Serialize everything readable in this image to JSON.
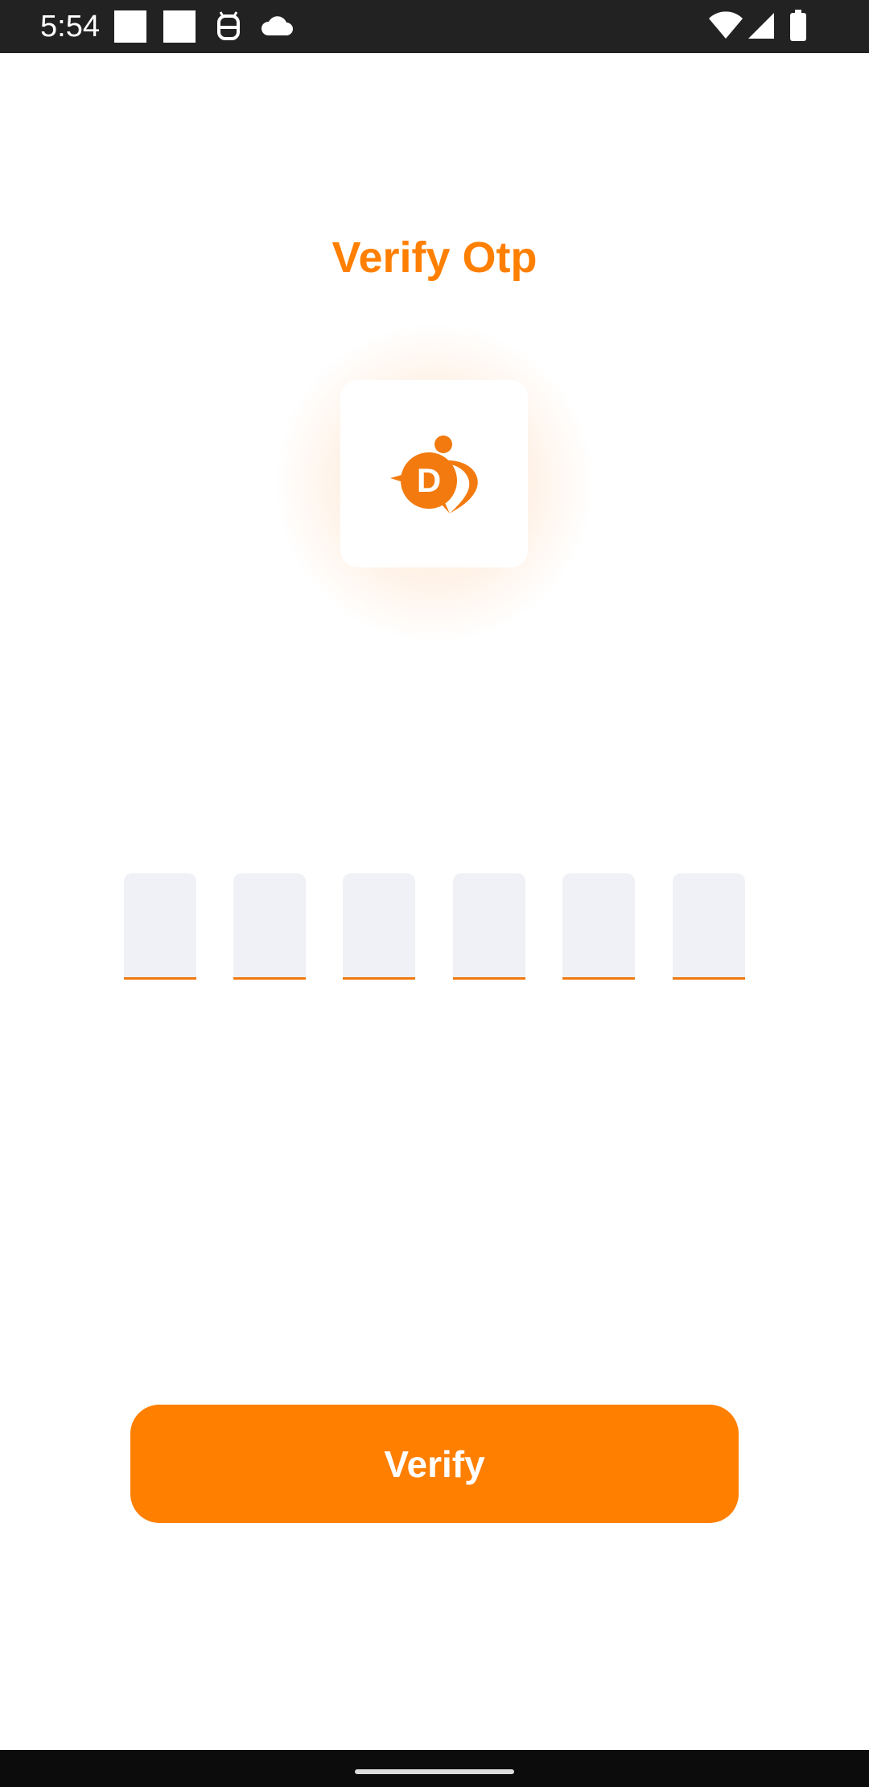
{
  "status_bar": {
    "time": "5:54",
    "left_icons": [
      "notification-square-icon",
      "notification-square-icon",
      "android-robot-icon",
      "cloud-icon"
    ],
    "right_icons": [
      "wifi-icon",
      "cellular-signal-icon",
      "battery-icon"
    ]
  },
  "screen": {
    "title": "Verify Otp",
    "logo_letter": "D",
    "logo_icon": "app-logo-icon",
    "otp": {
      "digit_count": 6,
      "values": [
        "",
        "",
        "",
        "",
        "",
        ""
      ]
    },
    "verify_button_label": "Verify"
  },
  "colors": {
    "accent": "#FF7F00",
    "otp_box_bg": "#F0F1F6",
    "otp_underline": "#F07A10",
    "status_bar_bg": "#222222",
    "nav_bar_bg": "#0c0c0c"
  }
}
